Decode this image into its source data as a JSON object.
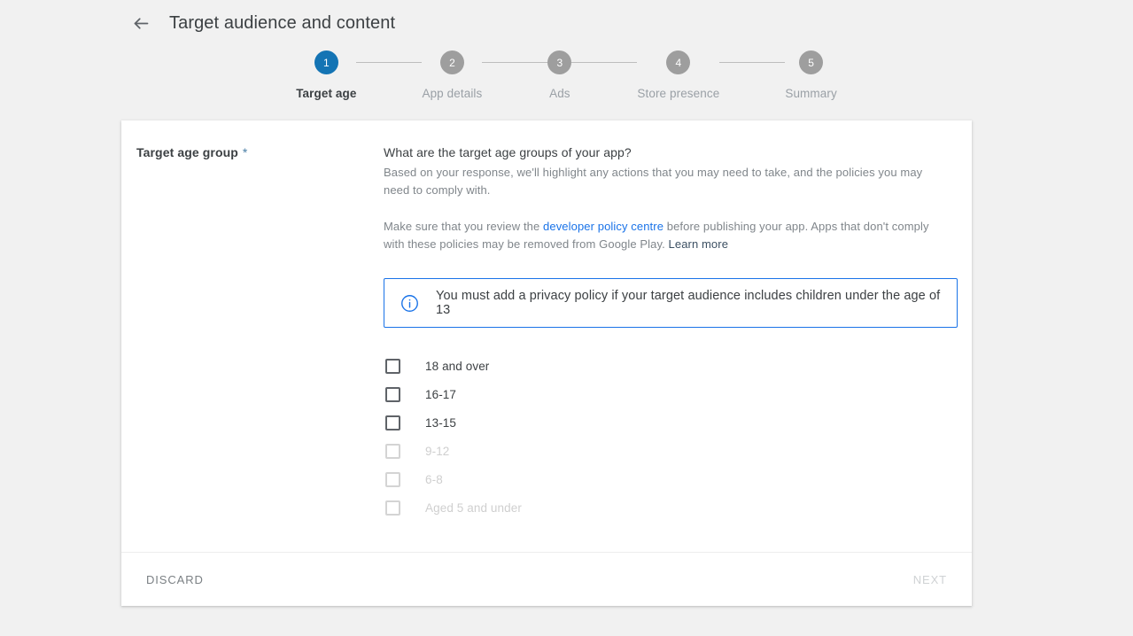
{
  "header": {
    "back_icon": "arrow-left-icon",
    "title": "Target audience and content"
  },
  "stepper": {
    "steps": [
      {
        "number": "1",
        "label": "Target age",
        "active": true
      },
      {
        "number": "2",
        "label": "App details",
        "active": false
      },
      {
        "number": "3",
        "label": "Ads",
        "active": false
      },
      {
        "number": "4",
        "label": "Store presence",
        "active": false
      },
      {
        "number": "5",
        "label": "Summary",
        "active": false
      }
    ]
  },
  "form": {
    "field_label": "Target age group",
    "required_marker": "*",
    "question_title": "What are the target age groups of your app?",
    "question_subtitle": "Based on your response, we'll highlight any actions that you may need to take, and the policies you may need to comply with.",
    "policy_text_before": "Make sure that you review the ",
    "policy_link": "developer policy centre",
    "policy_text_middle": " before publishing your app. Apps that don't comply with these policies may be removed from Google Play. ",
    "learn_more_link": "Learn more",
    "info_banner": {
      "icon": "info-circle-icon",
      "text": "You must add a privacy policy if your target audience includes children under the age of 13"
    },
    "age_options": [
      {
        "label": "18 and over",
        "checked": false,
        "disabled": false
      },
      {
        "label": "16-17",
        "checked": false,
        "disabled": false
      },
      {
        "label": "13-15",
        "checked": false,
        "disabled": false
      },
      {
        "label": "9-12",
        "checked": false,
        "disabled": true
      },
      {
        "label": "6-8",
        "checked": false,
        "disabled": true
      },
      {
        "label": "Aged 5 and under",
        "checked": false,
        "disabled": true
      }
    ]
  },
  "footer": {
    "discard_label": "DISCARD",
    "next_label": "NEXT"
  },
  "colors": {
    "page_background": "#f1f1f1",
    "card_background": "#ffffff",
    "accent_blue": "#1a73e8",
    "step_active": "#1474b4",
    "step_inactive": "#9e9e9e",
    "text_primary": "#3c4043",
    "text_secondary": "#80868b",
    "text_disabled": "#cfcfcf"
  }
}
